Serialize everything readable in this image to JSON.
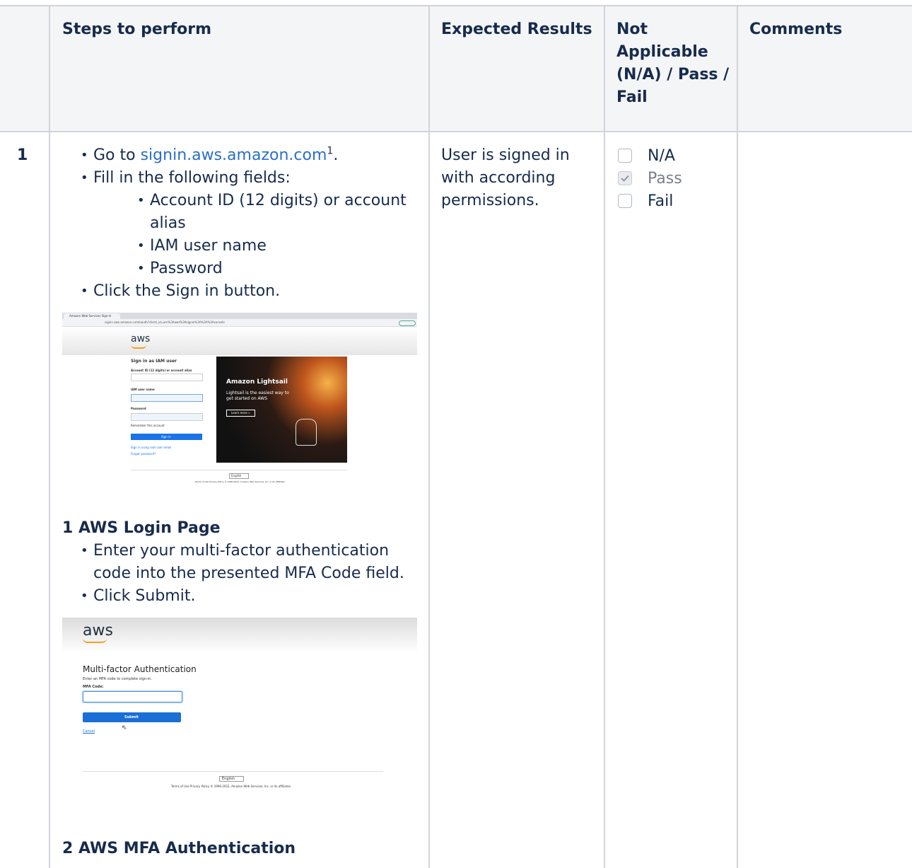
{
  "headers": {
    "steps": "Steps to perform",
    "expected": "Expected Results",
    "status": "Not Applicable (N/A) / Pass / Fail",
    "comments": "Comments"
  },
  "row": {
    "number": "1",
    "step1_prefix": "Go to ",
    "step1_link": "signin.aws.amazon.com",
    "step1_sup": "1",
    "step1_suffix": ".",
    "step2": "Fill in the following fields:",
    "sub1": "Account ID (12 digits) or account alias",
    "sub2": "IAM user name",
    "sub3": "Password",
    "step3": "Click the Sign in button.",
    "caption1": "1 AWS Login Page",
    "step4": "Enter your multi-factor authentication code into the presented MFA Code field.",
    "step5": "Click Submit.",
    "caption2": "2 AWS MFA Authentication",
    "expected": "User is signed in with according permissions.",
    "options": [
      {
        "label": "N/A",
        "checked": false
      },
      {
        "label": "Pass",
        "checked": true
      },
      {
        "label": "Fail",
        "checked": false
      }
    ]
  },
  "screenshot1": {
    "tab": "Amazon Web Services Sign-In",
    "url": "signin.aws.amazon.com/oauth?client_id=arn%3Aaws%3Asignin%3A%3A%3Aconsole",
    "update": "Update",
    "logo": "aws",
    "heading": "Sign in as IAM user",
    "account_label": "Account ID (12 digits) or account alias",
    "user_label": "IAM user name",
    "password_label": "Password",
    "remember": "Remember this account",
    "signin": "Sign in",
    "root_link": "Sign in using root user email",
    "forgot": "Forgot password?",
    "promo_title": "Amazon Lightsail",
    "promo_text": "Lightsail is the easiest way to get started on AWS",
    "promo_button": "Learn more »",
    "language": "English",
    "footer": "Terms of Use  Privacy Policy  © 1996-2022, Amazon Web Services, Inc. or its affiliates."
  },
  "screenshot2": {
    "logo": "aws",
    "heading": "Multi-factor Authentication",
    "instruction": "Enter an MFA code to complete sign-in.",
    "code_label": "MFA Code:",
    "submit": "Submit",
    "cancel": "Cancel",
    "language": "English",
    "footer": "Terms of Use  Privacy Policy  © 1996-2022, Amazon Web Services, Inc. or its affiliates."
  }
}
